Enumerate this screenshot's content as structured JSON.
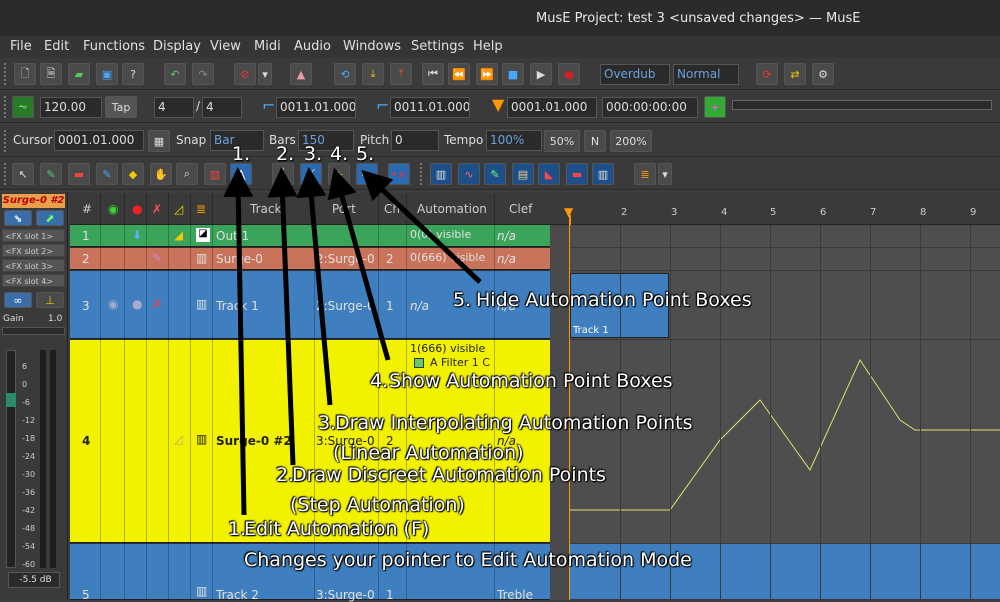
{
  "window": {
    "title": "MusE Project: test 3 <unsaved changes> — MusE"
  },
  "menu": [
    "File",
    "Edit",
    "Functions",
    "Display",
    "View",
    "Midi",
    "Audio",
    "Windows",
    "Settings",
    "Help"
  ],
  "transport": {
    "record_mode": "Overdub",
    "cycle_mode": "Normal"
  },
  "tempo_bar": {
    "tempo": "120.00",
    "tap_label": "Tap",
    "sig_num": "4",
    "sig_den": "4",
    "left_marker": "0011.01.000",
    "right_marker": "0011.01.000",
    "position": "0001.01.000",
    "time": "000:00:00:00"
  },
  "edit_bar": {
    "cursor_label": "Cursor",
    "cursor_value": "0001.01.000",
    "snap_label": "Snap",
    "snap_value": "Bar",
    "bars_label": "Bars",
    "bars_value": "150",
    "pitch_label": "Pitch",
    "pitch_value": "0",
    "tempo_label": "Tempo",
    "tempo_value": "100%",
    "btn_50": "50%",
    "btn_n": "N",
    "btn_200": "200%"
  },
  "mixer_strip": {
    "name": "Surge-0 #2",
    "fx_slots": [
      "<FX slot 1>",
      "<FX slot 2>",
      "<FX slot 3>",
      "<FX slot 4>"
    ],
    "gain_label": "Gain",
    "gain_value": "1.0",
    "scale": [
      "6",
      "0",
      "-6",
      "-12",
      "-18",
      "-24",
      "-30",
      "-36",
      "-42",
      "-48",
      "-54",
      "-60"
    ],
    "db_value": "-5.5 dB"
  },
  "track_header": {
    "num": "#",
    "track": "Track",
    "port": "Port",
    "ch": "Ch",
    "automation": "Automation",
    "clef": "Clef"
  },
  "tracks": [
    {
      "num": "1",
      "name": "Out 1",
      "port": "",
      "ch": "",
      "automation": "0(0) visible",
      "clef": "n/a",
      "color": "#3aa55a"
    },
    {
      "num": "2",
      "name": "Surge-0",
      "port": "2:Surge-0",
      "ch": "2",
      "automation": "0(666) visible",
      "clef": "n/a",
      "color": "#c8735a"
    },
    {
      "num": "3",
      "name": "Track 1",
      "port": "2:Surge-0",
      "ch": "1",
      "automation": "n/a",
      "clef": "n/a",
      "color": "#3f7fbf"
    },
    {
      "num": "4",
      "name": "Surge-0 #2",
      "port": "3:Surge-0",
      "ch": "2",
      "automation": "1(666) visible",
      "automation2": "A Filter 1 C",
      "clef": "n/a",
      "color": "#f2f200"
    },
    {
      "num": "5",
      "name": "Track 2",
      "port": "3:Surge-0",
      "ch": "1",
      "automation": "",
      "clef": "Treble",
      "color": "#3f7fbf"
    }
  ],
  "ruler": [
    "2",
    "3",
    "4",
    "5",
    "6",
    "7",
    "8",
    "9"
  ],
  "parts": [
    {
      "name": "Track 1"
    }
  ],
  "annotations": {
    "n1": "1.",
    "n2": "2.",
    "n3": "3.",
    "n4": "4.",
    "n5": "5.",
    "a5": "Hide Automation Point Boxes",
    "a5num": "5.",
    "a4": "Show Automation Point Boxes",
    "a4num": "4.",
    "a3": "Draw Interpolating Automation Points",
    "a3num": "3.",
    "a3b": "(Linear Automation)",
    "a2": "Draw Discreet Automation Points",
    "a2num": "2.",
    "a2b": "(Step Automation)",
    "a1": "Edit Automation (F)",
    "a1num": "1.",
    "a1b": "Changes your pointer to Edit Automation Mode"
  },
  "colors": {
    "accent": "#f0a000",
    "selected": "#f2f200"
  }
}
